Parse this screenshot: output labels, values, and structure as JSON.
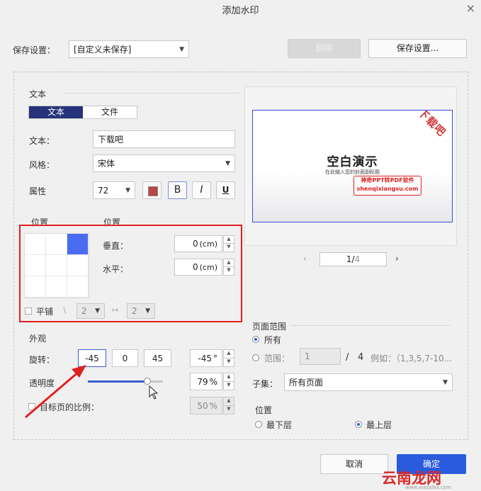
{
  "dialog": {
    "title": "添加水印",
    "close": "×"
  },
  "save_settings": {
    "label": "保存设置：",
    "selected": "[自定义未保存]",
    "delete_btn": "删除",
    "save_btn": "保存设置..."
  },
  "text_section": {
    "heading": "文本",
    "tabs": [
      "文本",
      "文件"
    ],
    "text_label": "文本：",
    "text_value": "下载吧",
    "style_label": "风格：",
    "style_value": "宋体",
    "attr_label": "属性",
    "font_size": "72",
    "bold": "B",
    "italic": "I",
    "underline": "U",
    "color": "#b84848"
  },
  "position_section": {
    "heading_left": "位置",
    "heading_right": "位置",
    "vertical_label": "垂直：",
    "vertical_value": "0",
    "vertical_unit": "(cm)",
    "horizontal_label": "水平：",
    "horizontal_value": "0",
    "horizontal_unit": "(cm)",
    "tile_label": "平铺",
    "tile_v": "2",
    "tile_h": "2"
  },
  "appearance": {
    "heading": "外观",
    "rotate_label": "旋转：",
    "rotate_options": [
      "-45",
      "0",
      "45"
    ],
    "rotate_value": "-45",
    "rotate_unit": "°",
    "opacity_label": "透明度",
    "opacity_value": "79",
    "opacity_unit": "%",
    "opacity_level": 0.79,
    "scale_label": "目标页的比例：",
    "scale_value": "50",
    "scale_unit": "%"
  },
  "preview": {
    "slide_title": "空白演示",
    "slide_subtitle": "在此输入您的封面副标题",
    "watermark_text": "下载吧",
    "stamp_line1": "神奇PPT转PDF软件",
    "stamp_line2": "shenqixiangsu.com",
    "page_current": "1",
    "page_total": "4",
    "page_sep": "/"
  },
  "page_range": {
    "heading": "页面范围",
    "all_label": "所有",
    "range_label": "范围：",
    "range_value": "1",
    "range_sep": "/",
    "range_total": "4",
    "range_example": "例如：（1,3,5,7-10...",
    "subset_label": "子集：",
    "subset_value": "所有页面"
  },
  "layer": {
    "heading": "位置",
    "bottom_label": "最下层",
    "top_label": "最上层"
  },
  "footer": {
    "cancel": "取消",
    "ok": "确定"
  },
  "overlay": {
    "stamp_text": "云南龙网",
    "stamp_url": "www.xiazaiba.com"
  },
  "colors": {
    "accent": "#2a5bdc",
    "tab_active": "#26337a",
    "highlight": "#e02020"
  }
}
